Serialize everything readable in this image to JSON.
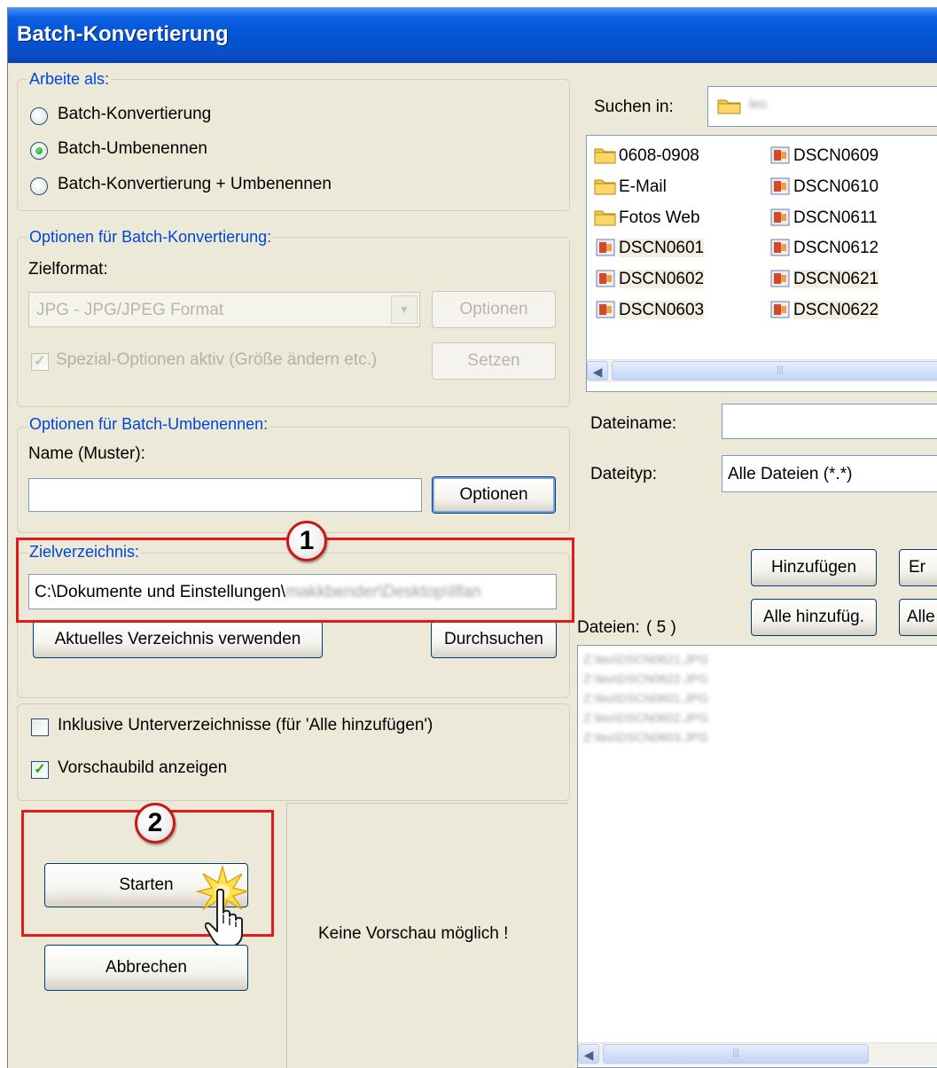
{
  "window": {
    "title": "Batch-Konvertierung"
  },
  "work_as": {
    "label": "Arbeite als:",
    "options": [
      {
        "label": "Batch-Konvertierung",
        "selected": false
      },
      {
        "label": "Batch-Umbenennen",
        "selected": true
      },
      {
        "label": "Batch-Konvertierung + Umbenennen",
        "selected": false
      }
    ]
  },
  "convert_options": {
    "label": "Optionen für Batch-Konvertierung:",
    "format_label": "Zielformat:",
    "format_value": "JPG - JPG/JPEG Format",
    "options_button": "Optionen",
    "special_checkbox": "Spezial-Optionen aktiv (Größe ändern etc.)",
    "special_checked": true,
    "set_button": "Setzen"
  },
  "rename_options": {
    "label": "Optionen für Batch-Umbenennen:",
    "name_label": "Name (Muster):",
    "name_value": "",
    "options_button": "Optionen"
  },
  "target_dir": {
    "label": "Zielverzeichnis:",
    "path_prefix": "C:\\Dokumente und Einstellungen\\",
    "path_blurred": "makkbender\\Desktop\\Ilfan",
    "use_current_button": "Aktuelles Verzeichnis verwenden",
    "browse_button": "Durchsuchen"
  },
  "checkboxes": {
    "subdirs_label": "Inklusive Unterverzeichnisse (für 'Alle hinzufügen')",
    "subdirs_checked": false,
    "preview_label": "Vorschaubild anzeigen",
    "preview_checked": true
  },
  "actions": {
    "start_button": "Starten",
    "cancel_button": "Abbrechen"
  },
  "preview": {
    "text": "Keine Vorschau möglich !"
  },
  "browser": {
    "look_in_label": "Suchen in:",
    "look_in_value": "leo",
    "files_col1": [
      {
        "name": "0608-0908",
        "type": "folder"
      },
      {
        "name": "E-Mail",
        "type": "folder"
      },
      {
        "name": "Fotos Web",
        "type": "folder"
      },
      {
        "name": "DSCN0601",
        "type": "image"
      },
      {
        "name": "DSCN0602",
        "type": "image"
      },
      {
        "name": "DSCN0603",
        "type": "image"
      }
    ],
    "files_col2": [
      {
        "name": "DSCN0609",
        "type": "image"
      },
      {
        "name": "DSCN0610",
        "type": "image"
      },
      {
        "name": "DSCN0611",
        "type": "image"
      },
      {
        "name": "DSCN0612",
        "type": "image"
      },
      {
        "name": "DSCN0621",
        "type": "image"
      },
      {
        "name": "DSCN0622",
        "type": "image"
      }
    ],
    "filename_label": "Dateiname:",
    "filename_value": "",
    "filetype_label": "Dateityp:",
    "filetype_value": "Alle Dateien (*.*)",
    "add_button": "Hinzufügen",
    "remove_button_partial": "Er",
    "add_all_button": "Alle hinzufüg.",
    "remove_all_button_partial": "Alle",
    "files_label": "Dateien:",
    "files_count": "( 5 )",
    "selected_files": [
      "Z:\\leo\\DSCN0621.JPG",
      "Z:\\leo\\DSCN0622.JPG",
      "Z:\\leo\\DSCN0601.JPG",
      "Z:\\leo\\DSCN0602.JPG",
      "Z:\\leo\\DSCN0603.JPG"
    ]
  },
  "annotations": {
    "step1": "1",
    "step2": "2",
    "highlight_color": "#e41a1a"
  }
}
